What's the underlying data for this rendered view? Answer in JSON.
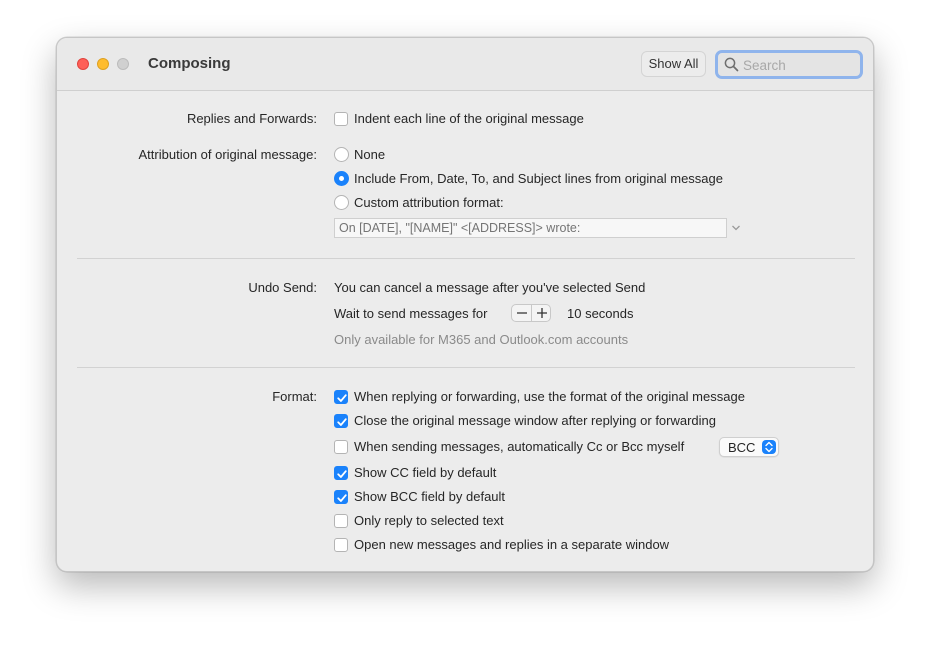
{
  "window": {
    "title": "Composing"
  },
  "toolbar": {
    "show_all_label": "Show All",
    "search_placeholder": "Search"
  },
  "replies": {
    "label": "Replies and Forwards:",
    "indent_label": "Indent each line of the original message",
    "indent_checked": false
  },
  "attribution": {
    "label": "Attribution of original message:",
    "options": [
      {
        "label": "None",
        "selected": false
      },
      {
        "label": "Include From, Date, To, and Subject lines from original message",
        "selected": true
      },
      {
        "label": "Custom attribution format:",
        "selected": false
      }
    ],
    "format_placeholder": "On [DATE], \"[NAME]\" <[ADDRESS]> wrote:"
  },
  "undo_send": {
    "label": "Undo Send:",
    "description": "You can cancel a message after you've selected Send",
    "wait_label": "Wait to send messages for",
    "wait_value": "10 seconds",
    "note": "Only available for M365 and Outlook.com accounts"
  },
  "format": {
    "label": "Format:",
    "options": [
      {
        "label": "When replying or forwarding, use the format of the original message",
        "checked": true
      },
      {
        "label": "Close the original message window after replying or forwarding",
        "checked": true
      },
      {
        "label": "When sending messages, automatically Cc or Bcc myself",
        "checked": false
      },
      {
        "label": "Show CC field by default",
        "checked": true
      },
      {
        "label": "Show BCC field by default",
        "checked": true
      },
      {
        "label": "Only reply to selected text",
        "checked": false
      },
      {
        "label": "Open new messages and replies in a separate window",
        "checked": false
      }
    ],
    "cc_bcc_selected": "BCC"
  },
  "colors": {
    "accent": "#1a82fb",
    "close": "#fe5f57",
    "minimize": "#febc2e",
    "zoom": "#d0d0d0"
  }
}
